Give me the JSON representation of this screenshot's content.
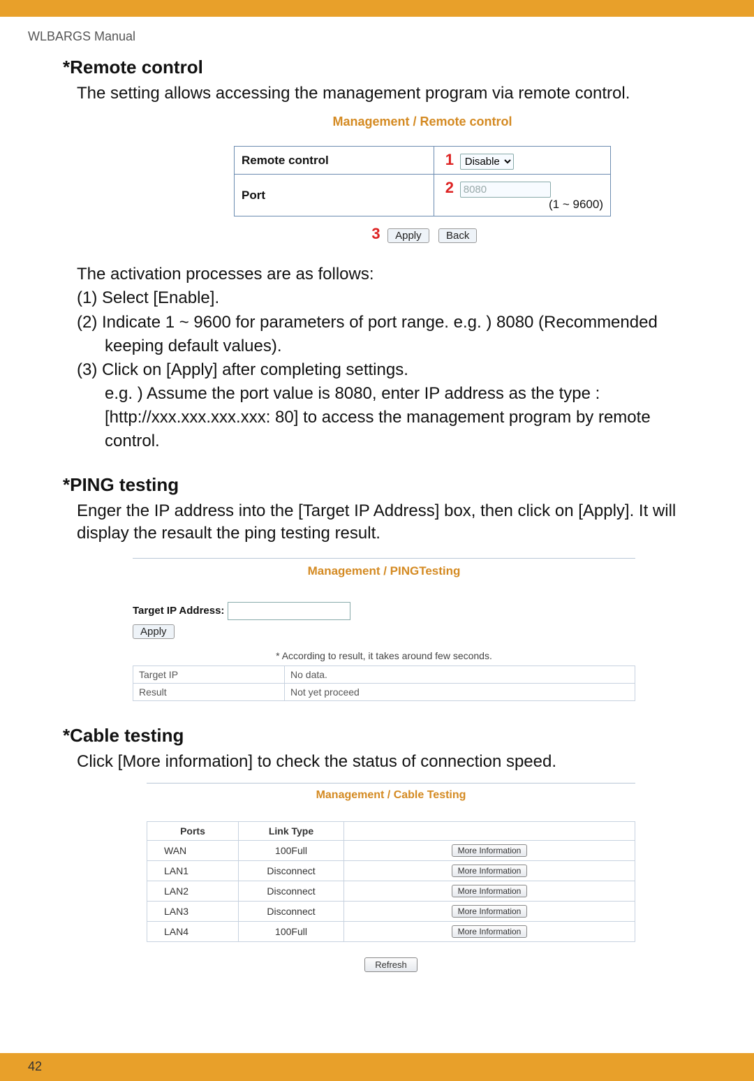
{
  "meta": {
    "manual": "WLBARGS Manual",
    "pageNumber": "42"
  },
  "sections": {
    "remote": {
      "heading": "*Remote control",
      "intro": "The setting allows accessing the management program via remote control.",
      "figTitle": "Management / Remote control",
      "rows": {
        "remoteLabel": "Remote control",
        "portLabel": "Port",
        "num1": "1",
        "num2": "2",
        "num3": "3",
        "selectValue": "Disable",
        "portValue": "8080",
        "portRange": "(1 ~ 9600)",
        "applyBtn": "Apply",
        "backBtn": "Back"
      },
      "steps": {
        "l0": " The activation processes are as follows:",
        "l1": "(1) Select [Enable].",
        "l2": "(2) Indicate 1 ~ 9600 for parameters of port range. e.g. ) 8080 (Recommended",
        "l2b": "      keeping default values).",
        "l3": "(3) Click on [Apply] after completing settings.",
        "l3b": "      e.g. ) Assume the port value is 8080, enter IP address as the type :",
        "l3c": "      [http://xxx.xxx.xxx.xxx: 80] to access the management program by remote",
        "l3d": "      control."
      }
    },
    "ping": {
      "heading": "*PING testing",
      "intro": "Enger the IP address into the [Target IP Address] box, then click on [Apply]. It will display the resault the ping testing result.",
      "figTitle": "Management / PINGTesting",
      "targetLabel": "Target IP Address:",
      "applyBtn": "Apply",
      "note": "* According to result, it takes around few seconds.",
      "result": {
        "r1l": "Target IP",
        "r1v": "No data.",
        "r2l": "Result",
        "r2v": "Not yet proceed"
      }
    },
    "cable": {
      "heading": "*Cable testing",
      "intro": "Click [More information] to check the status of connection speed.",
      "figTitle": "Management / Cable Testing",
      "headers": {
        "ports": "Ports",
        "link": "Link Type"
      },
      "rows": [
        {
          "port": "WAN",
          "link": "100Full"
        },
        {
          "port": "LAN1",
          "link": "Disconnect"
        },
        {
          "port": "LAN2",
          "link": "Disconnect"
        },
        {
          "port": "LAN3",
          "link": "Disconnect"
        },
        {
          "port": "LAN4",
          "link": "100Full"
        }
      ],
      "moreBtn": "More Information",
      "refreshBtn": "Refresh"
    }
  }
}
